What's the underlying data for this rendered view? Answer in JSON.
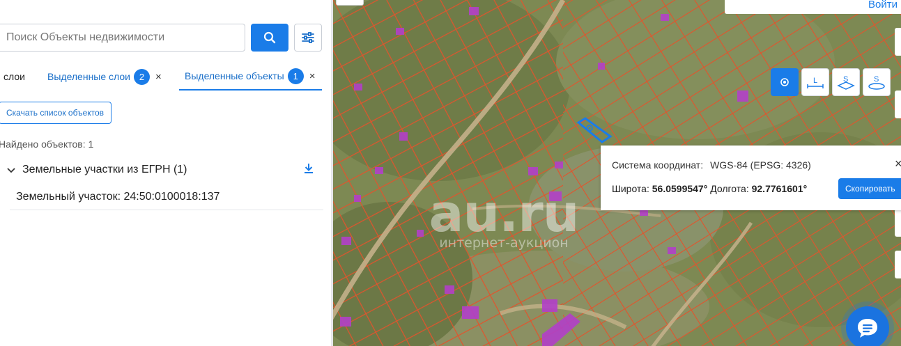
{
  "search": {
    "placeholder": "Поиск Объекты недвижимости",
    "button_icon": "search-icon",
    "filter_icon": "sliders-icon"
  },
  "tabs": [
    {
      "label": "слои"
    },
    {
      "label": "Выделенные слои",
      "count": "2",
      "close": "×"
    },
    {
      "label": "Выделенные объекты",
      "count": "1",
      "close": "×",
      "active": true
    }
  ],
  "download_button": "Скачать список объектов",
  "found_text": "Найдено объектов: 1",
  "group": {
    "title": "Земельные участки из ЕГРН (1)",
    "expand_icon": "chevron-down-icon",
    "download_icon": "download-icon"
  },
  "item": {
    "label": "Земельный участок: 24:50:0100018:137"
  },
  "map": {
    "login_link": "Войти",
    "tools": [
      {
        "icon": "point-icon",
        "active": true
      },
      {
        "icon": "length-icon",
        "label": "L"
      },
      {
        "icon": "area-icon",
        "label": "S"
      },
      {
        "icon": "area-alt-icon",
        "label": "S"
      }
    ],
    "popup": {
      "crs_label": "Система координат:",
      "crs_value": "WGS-84 (EPSG: 4326)",
      "lat_label": "Широта:",
      "lat_value": "56.0599547°",
      "lon_label": "Долгота:",
      "lon_value": "92.7761601°",
      "copy_button": "Скопировать",
      "close": "×"
    },
    "watermark": {
      "main": "au.ru",
      "sub": "интернет-аукцион"
    },
    "chat_icon": "chat-icon"
  },
  "colors": {
    "accent": "#1a7ce8",
    "parcel_border": "#e8532e",
    "building": "#b240c8",
    "selected": "#1a7ce8"
  }
}
